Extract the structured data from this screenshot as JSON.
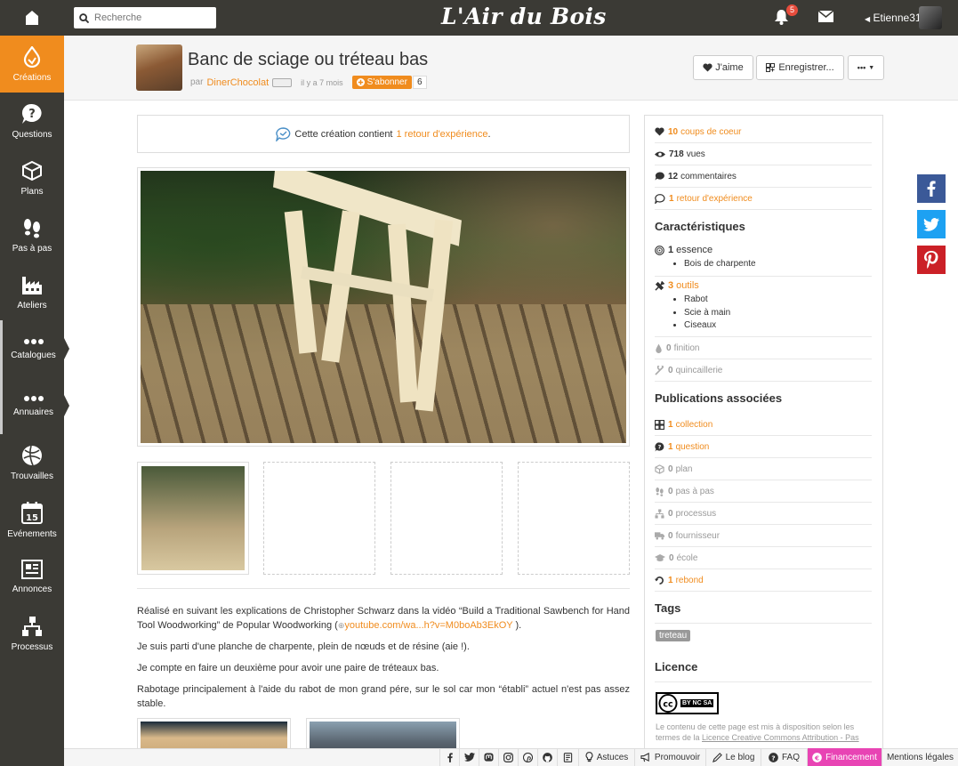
{
  "topbar": {
    "search_placeholder": "Recherche",
    "logo": "L'Air du Bois",
    "notifications_count": "5",
    "user_name": "Etienne31"
  },
  "sidebar": [
    {
      "label": "Créations",
      "icon": "creations-icon",
      "active": true
    },
    {
      "label": "Questions",
      "icon": "question-icon"
    },
    {
      "label": "Plans",
      "icon": "cube-icon"
    },
    {
      "label": "Pas à pas",
      "icon": "footsteps-icon"
    },
    {
      "label": "Ateliers",
      "icon": "factory-icon"
    },
    {
      "label": "Catalogues",
      "icon": "dots-icon",
      "section": true
    },
    {
      "label": "Annuaires",
      "icon": "dots-icon",
      "section": true
    },
    {
      "label": "Trouvailles",
      "icon": "ball-icon"
    },
    {
      "label": "Evénements",
      "icon": "calendar-icon"
    },
    {
      "label": "Annonces",
      "icon": "newspaper-icon"
    },
    {
      "label": "Processus",
      "icon": "flow-icon"
    }
  ],
  "calendar_day": "15",
  "header": {
    "title": "Banc de sciage ou tréteau bas",
    "by": "par",
    "author": "DinerChocolat",
    "time": "il y a 7 mois",
    "subscribe_label": "S'abonner",
    "subscribe_count": "6",
    "like_label": "J'aime",
    "save_label": "Enregistrer...",
    "more_label": "•••"
  },
  "feedback": {
    "prefix": "Cette création contient",
    "link": "1 retour d'expérience",
    "suffix": "."
  },
  "description": {
    "p1_a": "Réalisé en suivant les explications de Christopher Schwarz dans la vidéo “Build a Traditional Sawbench for Hand Tool Woodworking” de Popular Woodworking (",
    "p1_link": "youtube.com/wa...h?v=M0boAb3EkOY",
    "p1_b": " ).",
    "p2": "Je suis parti d'une planche de charpente, plein de nœuds et de résine (aie !).",
    "p3": "Je compte en faire un deuxième pour avoir une paire de tréteaux bas.",
    "p4": "Rabotage principalement à l'aide du rabot de mon grand pére, sur le sol car mon “établi” actuel n'est pas assez stable."
  },
  "stats": {
    "likes_num": "10",
    "likes_label": "coups de coeur",
    "views_num": "718",
    "views_label": "vues",
    "comments_num": "12",
    "comments_label": "commentaires",
    "feedback_num": "1",
    "feedback_label": "retour d'expérience"
  },
  "characteristics": {
    "title": "Caractéristiques",
    "essence_num": "1",
    "essence_label": "essence",
    "essences": [
      "Bois de charpente"
    ],
    "tools_num": "3",
    "tools_label": "outils",
    "tools": [
      "Rabot",
      "Scie à main",
      "Ciseaux"
    ],
    "finish_num": "0",
    "finish_label": "finition",
    "hardware_num": "0",
    "hardware_label": "quincaillerie"
  },
  "publications": {
    "title": "Publications associées",
    "items": [
      {
        "num": "1",
        "label": "collection",
        "active": true
      },
      {
        "num": "1",
        "label": "question",
        "active": true
      },
      {
        "num": "0",
        "label": "plan"
      },
      {
        "num": "0",
        "label": "pas à pas"
      },
      {
        "num": "0",
        "label": "processus"
      },
      {
        "num": "0",
        "label": "fournisseur"
      },
      {
        "num": "0",
        "label": "école"
      },
      {
        "num": "1",
        "label": "rebond",
        "active": true
      }
    ]
  },
  "tags": {
    "title": "Tags",
    "items": [
      "treteau"
    ]
  },
  "licence": {
    "title": "Licence",
    "badge": "BY NC SA",
    "text_a": "Le contenu de cette page est mis à disposition selon les termes de la ",
    "text_link": "Licence Creative Commons Attribution - Pas"
  },
  "footer": {
    "astuces": "Astuces",
    "promouvoir": "Promouvoir",
    "blog": "Le blog",
    "faq": "FAQ",
    "financement": "Financement",
    "mentions": "Mentions légales"
  },
  "colors": {
    "accent": "#f08c1e",
    "dark": "#3b3a35",
    "facebook": "#3b5998",
    "twitter": "#1da1f2",
    "pinterest": "#cb2027",
    "financement": "#e844b4"
  }
}
